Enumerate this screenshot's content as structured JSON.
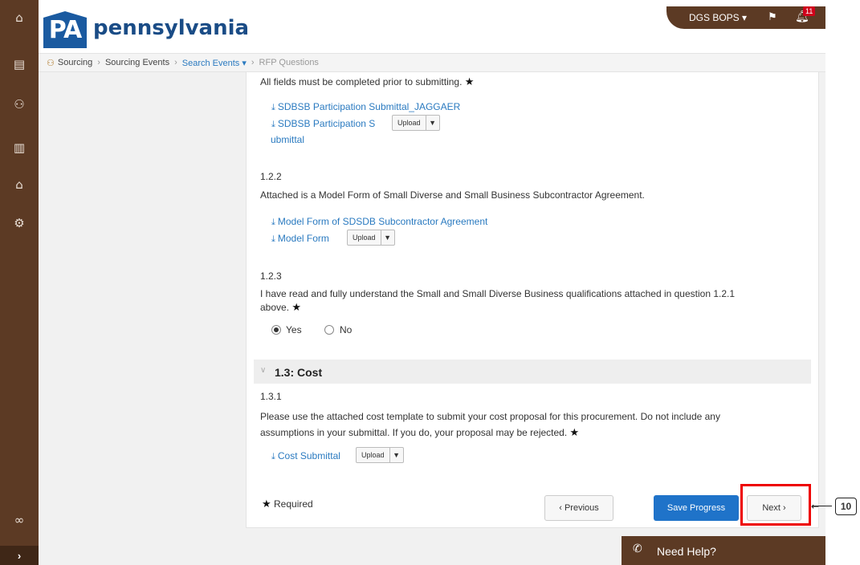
{
  "header": {
    "logo_text": "PA",
    "state_name": "pennsylvania",
    "user_menu": "DGS BOPS ▾",
    "notification_count": "11"
  },
  "breadcrumb": {
    "items": [
      "Sourcing",
      "Sourcing Events",
      "Search Events ▾",
      "RFP Questions"
    ]
  },
  "sidebar": {
    "icons": [
      "home-icon",
      "documents-icon",
      "sourcing-icon",
      "analytics-icon",
      "supplier-icon",
      "settings-icon",
      "binoculars-icon"
    ],
    "expand_label": "›"
  },
  "form": {
    "q121_note": "All fields must be completed prior to submitting.",
    "q121_link1": "SDBSB Participation Submittal_JAGGAER",
    "q121_link2_a": "SDBSB Participation S",
    "q121_link2_b": "ubmittal",
    "q122_num": "1.2.2",
    "q122_text": "Attached is a Model Form of Small Diverse and Small Business Subcontractor Agreement.",
    "q122_link1": "Model Form of SDSDB Subcontractor Agreement",
    "q122_link2": "Model Form",
    "q123_num": "1.2.3",
    "q123_text_line1": "I have read and fully understand the Small and Small Diverse Business qualifications attached in question 1.2.1",
    "q123_text_line2": "above.",
    "radio_yes": "Yes",
    "radio_no": "No",
    "section_title": "1.3: Cost",
    "q131_num": "1.3.1",
    "q131_text_line1": "Please use the attached cost template to submit your cost proposal for this procurement. Do not include any",
    "q131_text_line2": "assumptions in your submittal. If you do, your proposal may be rejected.",
    "q131_link": "Cost Submittal",
    "upload_label": "Upload",
    "required_label": "Required"
  },
  "buttons": {
    "previous": "‹ Previous",
    "save": "Save Progress",
    "next": "Next ›"
  },
  "callout": {
    "number": "10"
  },
  "help": {
    "label": "Need Help?"
  },
  "colors": {
    "brand_brown": "#5c3a24",
    "primary_blue": "#1f73c9",
    "link_blue": "#2a7ac0",
    "highlight_red": "#e00000"
  }
}
